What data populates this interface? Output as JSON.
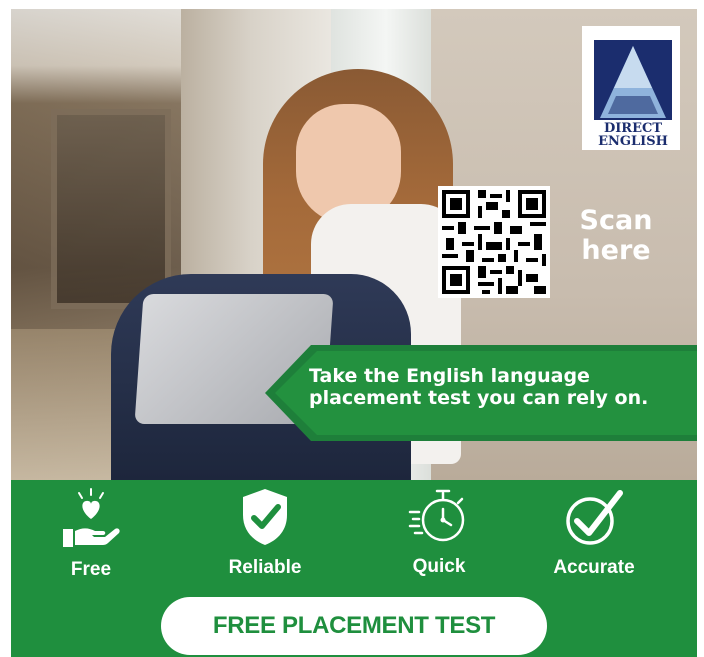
{
  "brand": {
    "logo_line1": "DIRECT",
    "logo_line2": "ENGLISH",
    "logo_color": "#1b2d6e",
    "triangle_light": "#a9c8e8"
  },
  "qr": {
    "caption_line1": "Scan",
    "caption_line2": "here"
  },
  "banner": {
    "line1": "Take the English language",
    "line2": "placement test you can rely on."
  },
  "features": [
    {
      "icon": "heart-hand-icon",
      "label": "Free"
    },
    {
      "icon": "shield-check-icon",
      "label": "Reliable"
    },
    {
      "icon": "stopwatch-icon",
      "label": "Quick"
    },
    {
      "icon": "circle-check-icon",
      "label": "Accurate"
    }
  ],
  "cta": {
    "label": "FREE PLACEMENT TEST"
  },
  "colors": {
    "green": "#1f8f3e",
    "white": "#ffffff"
  }
}
